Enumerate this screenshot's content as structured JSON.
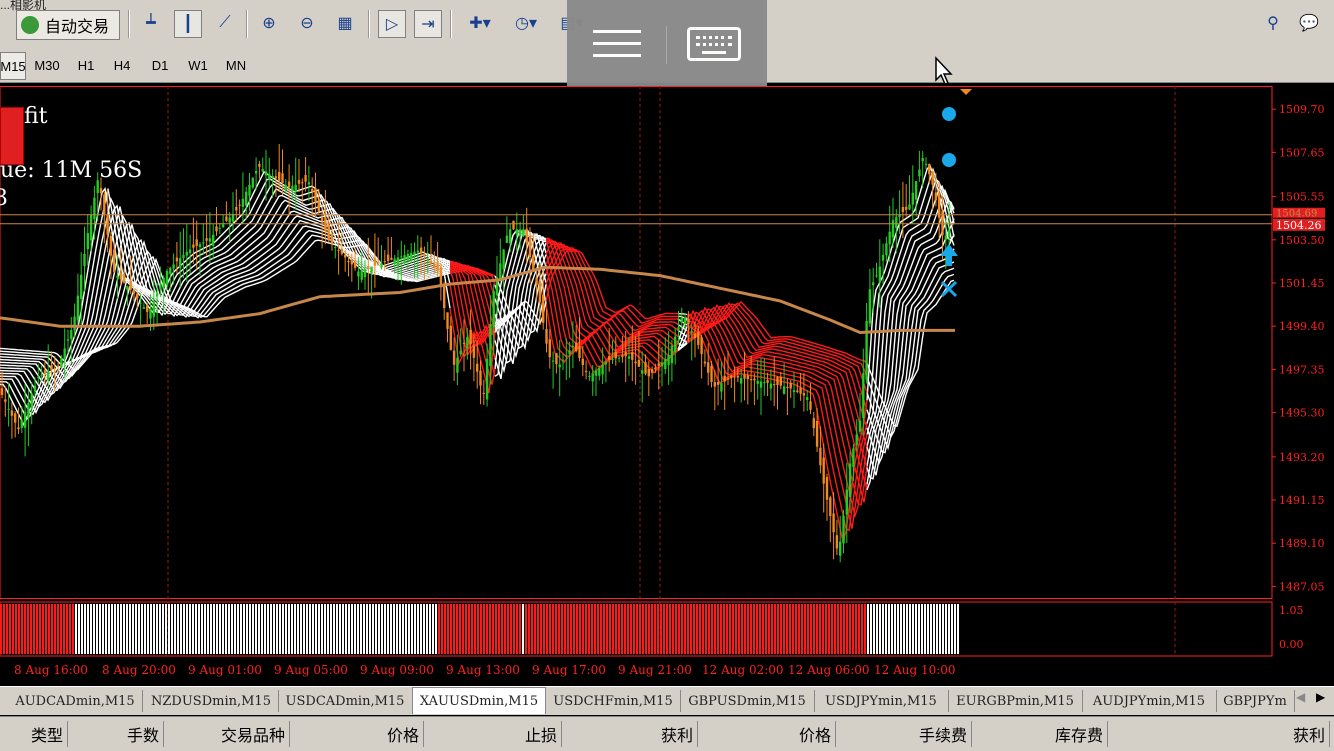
{
  "window": {
    "title_fragment": "...相影机"
  },
  "toolbar": {
    "autotrade_label": "自动交易",
    "icons": [
      "bar-chart-icon",
      "candlestick-icon",
      "line-chart-icon",
      "zoom-in-icon",
      "zoom-out-icon",
      "tile-windows-icon",
      "chart-shift-icon",
      "autoscroll-icon",
      "new-order-icon",
      "clock-icon",
      "template-icon"
    ],
    "right_icons": [
      "search-icon",
      "chat-icon"
    ]
  },
  "timeframes": [
    "M15",
    "M30",
    "H1",
    "H4",
    "D1",
    "W1",
    "MN"
  ],
  "active_timeframe": "M15",
  "overlay": {
    "icons": [
      "menu-icon",
      "keyboard-icon"
    ]
  },
  "chart": {
    "symbol": "XAUUSDmin,M15",
    "info_lines": [
      "fit",
      "ue: 11M 56S",
      "3"
    ],
    "price_labels": [
      "1509.70",
      "1507.65",
      "1505.55",
      "1504.26",
      "1503.50",
      "1501.45",
      "1499.40",
      "1497.35",
      "1495.30",
      "1493.20",
      "1491.15",
      "1489.10",
      "1487.05"
    ],
    "current_price": "1504.26",
    "ask_price": "1504.69",
    "indicator_labels": [
      "1.05",
      "0.00"
    ],
    "time_labels": [
      "8 Aug 16:00",
      "8 Aug 20:00",
      "9 Aug 01:00",
      "9 Aug 05:00",
      "9 Aug 09:00",
      "9 Aug 13:00",
      "9 Aug 17:00",
      "9 Aug 21:00",
      "12 Aug 02:00",
      "12 Aug 06:00",
      "12 Aug 10:00"
    ],
    "colors": {
      "bull": "#22cc22",
      "bear": "#f08a1e",
      "ribbon_up": "#ffffff",
      "ribbon_down": "#ff1a1a",
      "ma": "#c8874a",
      "axis": "#ff2020",
      "grid": "#a01818",
      "signal": "#19a8ea"
    }
  },
  "tabs": [
    {
      "label": "AUDCADmin,M15"
    },
    {
      "label": "NZDUSDmin,M15"
    },
    {
      "label": "USDCADmin,M15"
    },
    {
      "label": "XAUUSDmin,M15",
      "active": true
    },
    {
      "label": "USDCHFmin,M15"
    },
    {
      "label": "GBPUSDmin,M15"
    },
    {
      "label": "USDJPYmin,M15"
    },
    {
      "label": "EURGBPmin,M15"
    },
    {
      "label": "AUDJPYmin,M15"
    },
    {
      "label": "GBPJPYm"
    }
  ],
  "columns": [
    "类型",
    "手数",
    "交易品种",
    "价格",
    "止损",
    "获利",
    "价格",
    "手续费",
    "库存费",
    "获利"
  ]
}
